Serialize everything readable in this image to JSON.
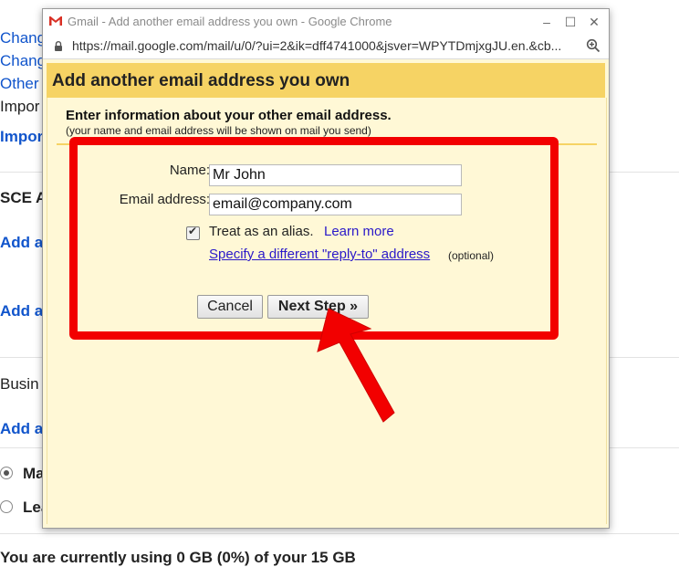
{
  "background": {
    "items": [
      {
        "text": "Chang",
        "kind": "link"
      },
      {
        "text": "Chang",
        "kind": "link"
      },
      {
        "text": "Other",
        "kind": "link"
      },
      {
        "text": "Impor",
        "kind": "plain"
      },
      {
        "text": "Impor",
        "kind": "blink"
      },
      {
        "text": "SCE A",
        "kind": "bold"
      },
      {
        "text": "Add a",
        "kind": "blink"
      },
      {
        "text": "Add a",
        "kind": "blink"
      },
      {
        "text": "Busin",
        "kind": "plain"
      },
      {
        "text": "Add a",
        "kind": "blink"
      },
      {
        "text": "Ma",
        "kind": "bold"
      },
      {
        "text": "Lea",
        "kind": "bold"
      }
    ],
    "storage_text": "You are currently using 0 GB (0%) of your 15 GB"
  },
  "window": {
    "title": "Gmail - Add another email address you own - Google Chrome",
    "url": "https://mail.google.com/mail/u/0/?ui=2&ik=dff4741000&jsver=WPYTDmjxgJU.en.&cb...",
    "controls": {
      "minimize": "–",
      "maximize": "☐",
      "close": "✕"
    }
  },
  "dialog": {
    "title": "Add another email address you own",
    "intro": "Enter information about your other email address.",
    "subtitle": "(your name and email address will be shown on mail you send)",
    "name_label": "Name:",
    "name_value": "Mr John",
    "email_label": "Email address:",
    "email_value": "email@company.com",
    "alias_label": "Treat as an alias.",
    "alias_checked": true,
    "learn_more": "Learn more",
    "reply_to_link": "Specify a different \"reply-to\" address",
    "optional": "(optional)",
    "cancel": "Cancel",
    "next": "Next Step »"
  },
  "colors": {
    "header": "#f6d364",
    "panel": "#fff8d6",
    "highlight": "#f20000",
    "link": "#2a19c9"
  }
}
